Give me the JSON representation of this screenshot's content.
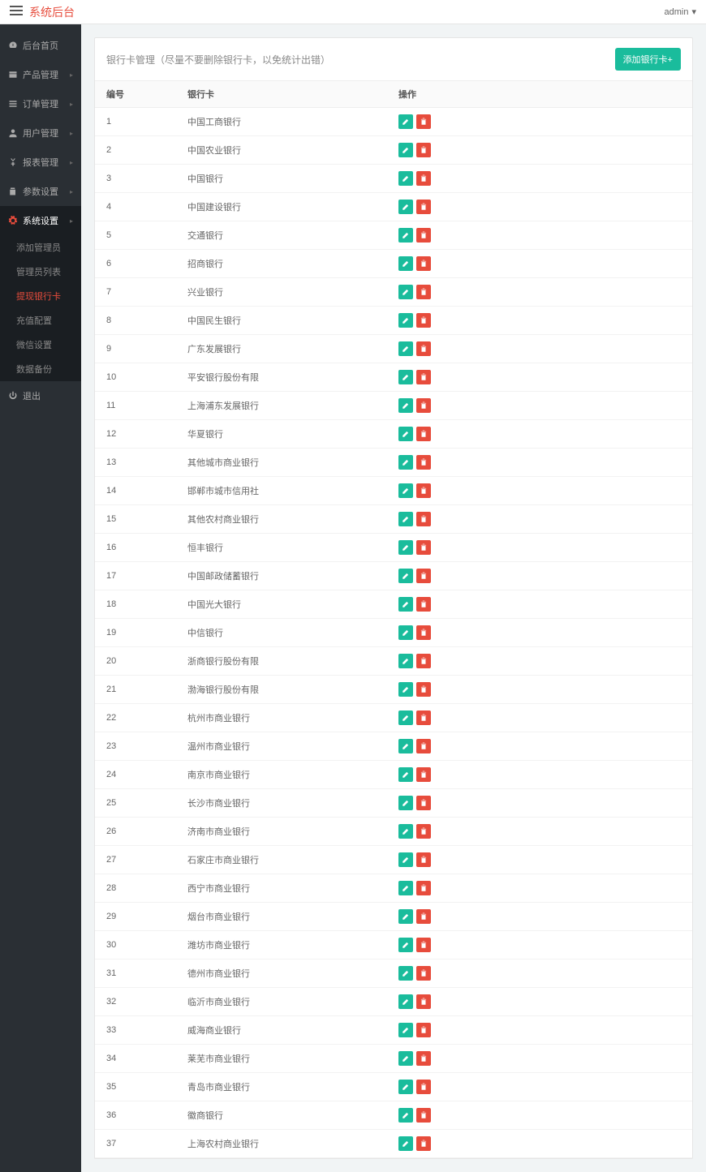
{
  "header": {
    "brand": "系统后台",
    "user": "admin"
  },
  "sidebar": {
    "items": [
      {
        "label": "后台首页",
        "icon": "dashboard"
      },
      {
        "label": "产品管理",
        "icon": "box",
        "caret": true
      },
      {
        "label": "订单管理",
        "icon": "list",
        "caret": true
      },
      {
        "label": "用户管理",
        "icon": "user",
        "caret": true
      },
      {
        "label": "报表管理",
        "icon": "yen",
        "caret": true
      },
      {
        "label": "参数设置",
        "icon": "copy",
        "caret": true
      },
      {
        "label": "系统设置",
        "icon": "gears",
        "caret": true,
        "active": true,
        "children": [
          {
            "label": "添加管理员"
          },
          {
            "label": "管理员列表"
          },
          {
            "label": "提现银行卡",
            "active": true
          },
          {
            "label": "充值配置"
          },
          {
            "label": "微信设置"
          },
          {
            "label": "数据备份"
          }
        ]
      },
      {
        "label": "退出",
        "icon": "power"
      }
    ]
  },
  "panel": {
    "title": "银行卡管理（尽量不要删除银行卡，以免统计出错）",
    "add_label": "添加银行卡+"
  },
  "table": {
    "headers": {
      "id": "编号",
      "bank": "银行卡",
      "op": "操作"
    },
    "rows": [
      {
        "id": "1",
        "bank": "中国工商银行"
      },
      {
        "id": "2",
        "bank": "中国农业银行"
      },
      {
        "id": "3",
        "bank": "中国银行"
      },
      {
        "id": "4",
        "bank": "中国建设银行"
      },
      {
        "id": "5",
        "bank": "交通银行"
      },
      {
        "id": "6",
        "bank": "招商银行"
      },
      {
        "id": "7",
        "bank": "兴业银行"
      },
      {
        "id": "8",
        "bank": "中国民生银行"
      },
      {
        "id": "9",
        "bank": "广东发展银行"
      },
      {
        "id": "10",
        "bank": "平安银行股份有限"
      },
      {
        "id": "11",
        "bank": "上海浦东发展银行"
      },
      {
        "id": "12",
        "bank": "华夏银行"
      },
      {
        "id": "13",
        "bank": "其他城市商业银行"
      },
      {
        "id": "14",
        "bank": "邯郸市城市信用社"
      },
      {
        "id": "15",
        "bank": "其他农村商业银行"
      },
      {
        "id": "16",
        "bank": "恒丰银行"
      },
      {
        "id": "17",
        "bank": "中国邮政储蓄银行"
      },
      {
        "id": "18",
        "bank": "中国光大银行"
      },
      {
        "id": "19",
        "bank": "中信银行"
      },
      {
        "id": "20",
        "bank": "浙商银行股份有限"
      },
      {
        "id": "21",
        "bank": "渤海银行股份有限"
      },
      {
        "id": "22",
        "bank": "杭州市商业银行"
      },
      {
        "id": "23",
        "bank": "温州市商业银行"
      },
      {
        "id": "24",
        "bank": "南京市商业银行"
      },
      {
        "id": "25",
        "bank": "长沙市商业银行"
      },
      {
        "id": "26",
        "bank": "济南市商业银行"
      },
      {
        "id": "27",
        "bank": "石家庄市商业银行"
      },
      {
        "id": "28",
        "bank": "西宁市商业银行"
      },
      {
        "id": "29",
        "bank": "烟台市商业银行"
      },
      {
        "id": "30",
        "bank": "潍坊市商业银行"
      },
      {
        "id": "31",
        "bank": "德州市商业银行"
      },
      {
        "id": "32",
        "bank": "临沂市商业银行"
      },
      {
        "id": "33",
        "bank": "威海商业银行"
      },
      {
        "id": "34",
        "bank": "莱芜市商业银行"
      },
      {
        "id": "35",
        "bank": "青岛市商业银行"
      },
      {
        "id": "36",
        "bank": "徽商银行"
      },
      {
        "id": "37",
        "bank": "上海农村商业银行"
      }
    ]
  }
}
